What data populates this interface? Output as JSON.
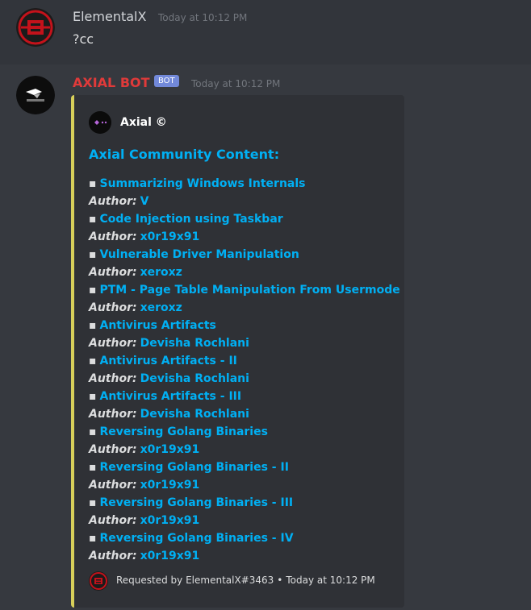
{
  "messages": [
    {
      "username": "ElementalX",
      "timestamp": "Today at 10:12 PM",
      "content": "?cc"
    },
    {
      "username": "AXIAL BOT",
      "bot_tag": "BOT",
      "timestamp": "Today at 10:12 PM",
      "embed": {
        "author_name": "Axial ©",
        "title": "Axial Community Content:",
        "author_label": "Author:",
        "bullet": "▪",
        "entries": [
          {
            "title": "Summarizing Windows Internals",
            "author": "V"
          },
          {
            "title": "Code Injection using Taskbar",
            "author": "x0r19x91"
          },
          {
            "title": "Vulnerable Driver Manipulation",
            "author": "xeroxz"
          },
          {
            "title": "PTM - Page Table Manipulation From Usermode",
            "author": "xeroxz"
          },
          {
            "title": "Antivirus Artifacts",
            "author": "Devisha Rochlani"
          },
          {
            "title": "Antivirus Artifacts - II",
            "author": "Devisha Rochlani"
          },
          {
            "title": "Antivirus Artifacts - III",
            "author": "Devisha Rochlani"
          },
          {
            "title": "Reversing Golang Binaries",
            "author": "x0r19x91"
          },
          {
            "title": "Reversing Golang Binaries - II",
            "author": "x0r19x91"
          },
          {
            "title": "Reversing Golang Binaries - III",
            "author": "x0r19x91"
          },
          {
            "title": "Reversing Golang Binaries - IV",
            "author": "x0r19x91"
          }
        ],
        "footer_text": "Requested by ElementalX#3463",
        "footer_separator": "•",
        "footer_timestamp": "Today at 10:12 PM"
      }
    }
  ],
  "colors": {
    "background": "#36393f",
    "embed_background": "#2f3136",
    "embed_accent": "#d7cf5a",
    "link": "#00b0f4",
    "bot_username": "#e03a3a",
    "bot_tag": "#7289da"
  }
}
